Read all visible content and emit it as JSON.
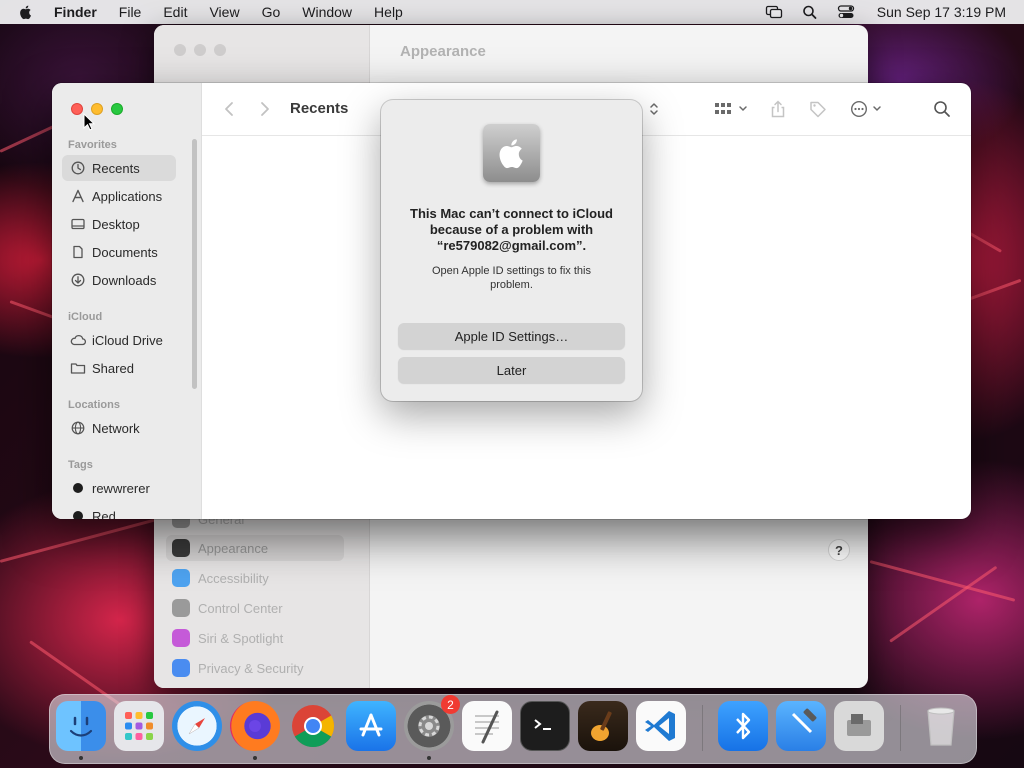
{
  "menubar": {
    "app": "Finder",
    "items": [
      "File",
      "Edit",
      "View",
      "Go",
      "Window",
      "Help"
    ],
    "status_icons": [
      "screen-mirroring-icon",
      "search-icon",
      "control-center-icon"
    ],
    "clock": "Sun Sep 17  3:19 PM"
  },
  "settings": {
    "pane_title": "Appearance",
    "sidebar": [
      {
        "label": "General",
        "icon_color": "#9a9a9a"
      },
      {
        "label": "Appearance",
        "icon_color": "#3b3b3b"
      },
      {
        "label": "Accessibility",
        "icon_color": "#4ea3f0"
      },
      {
        "label": "Control Center",
        "icon_color": "#9a9a9a"
      },
      {
        "label": "Siri & Spotlight",
        "icon_color": "#c55ad8"
      },
      {
        "label": "Privacy & Security",
        "icon_color": "#4a8cf0"
      }
    ],
    "help": "?"
  },
  "finder": {
    "title": "Recents",
    "sections": {
      "favorites": "Favorites",
      "icloud": "iCloud",
      "locations": "Locations",
      "tags": "Tags"
    },
    "favorites": [
      "Recents",
      "Applications",
      "Desktop",
      "Documents",
      "Downloads"
    ],
    "icloud": [
      "iCloud Drive",
      "Shared"
    ],
    "locations": [
      "Network"
    ],
    "tags": [
      {
        "label": "rewwrerer",
        "color": "#1d1d1d"
      },
      {
        "label": "Red",
        "color": "#1d1d1d"
      }
    ]
  },
  "alert": {
    "heading": "This Mac can’t connect to iCloud because of a problem with “re579082@gmail.com”.",
    "message": "Open Apple ID settings to fix this problem.",
    "primary_button": "Apple ID Settings…",
    "secondary_button": "Later"
  },
  "dock": {
    "apps": [
      {
        "name": "Finder",
        "running": true
      },
      {
        "name": "Launchpad",
        "running": false
      },
      {
        "name": "Safari",
        "running": false
      },
      {
        "name": "Firefox",
        "running": true
      },
      {
        "name": "Chrome",
        "running": false
      },
      {
        "name": "App Store",
        "running": false
      },
      {
        "name": "System Settings",
        "running": true,
        "badge": "2"
      },
      {
        "name": "TextEdit",
        "running": false
      },
      {
        "name": "Terminal",
        "running": false
      },
      {
        "name": "GarageBand",
        "running": false
      },
      {
        "name": "Visual Studio Code",
        "running": false
      },
      {
        "name": "Bluetooth",
        "running": false
      },
      {
        "name": "Xcode",
        "running": false
      },
      {
        "name": "Boot Camp Assistant",
        "running": false
      },
      {
        "name": "Trash",
        "running": false
      }
    ]
  }
}
